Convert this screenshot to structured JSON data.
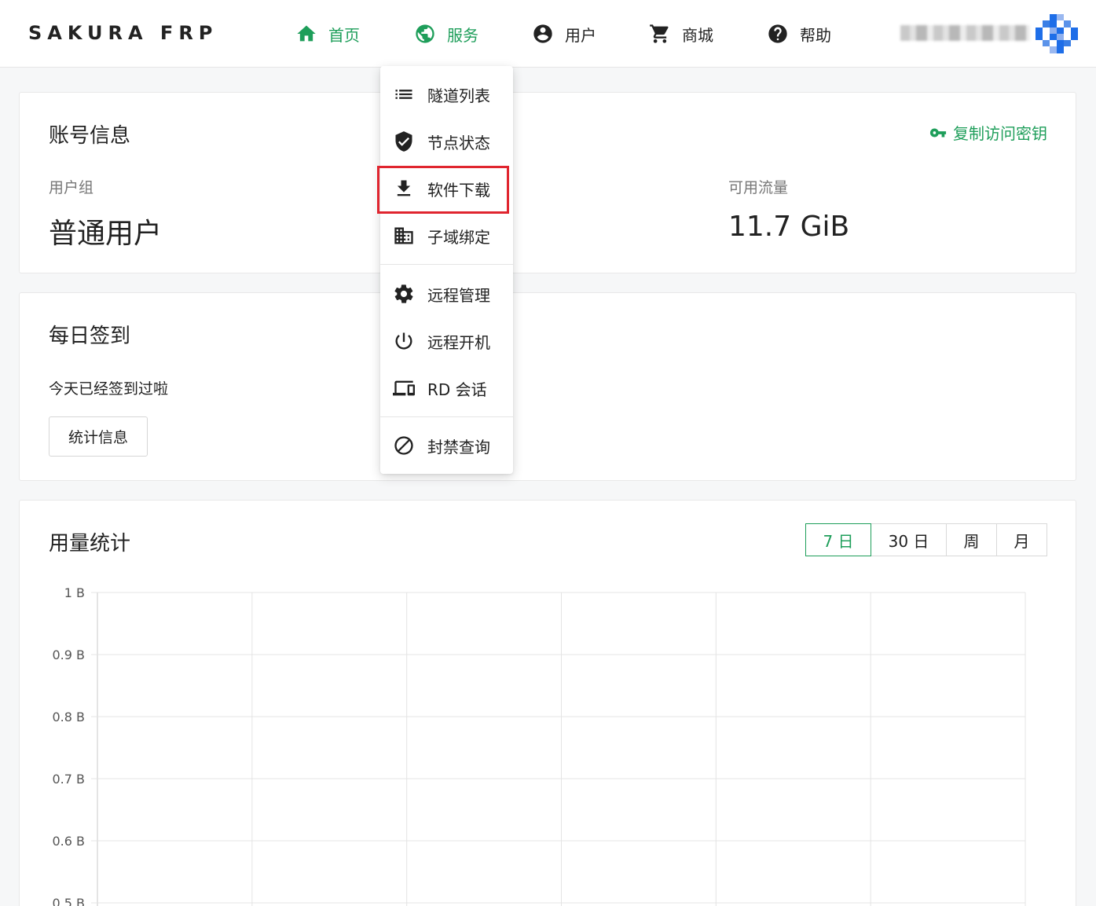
{
  "brand": "SAKURA FRP",
  "nav": {
    "home": "首页",
    "service": "服务",
    "user": "用户",
    "shop": "商城",
    "help": "帮助"
  },
  "service_menu": {
    "tunnels": "隧道列表",
    "nodes": "节点状态",
    "download": "软件下载",
    "subdomain": "子域绑定",
    "remote_manage": "远程管理",
    "remote_boot": "远程开机",
    "rd_session": "RD 会话",
    "ban_query": "封禁查询"
  },
  "account": {
    "title": "账号信息",
    "copy_key": "复制访问密钥",
    "group_label": "用户组",
    "group_value": "普通用户",
    "traffic_label": "可用流量",
    "traffic_value": "11.7 GiB"
  },
  "checkin": {
    "title": "每日签到",
    "status": "今天已经签到过啦",
    "stats_button": "统计信息"
  },
  "usage": {
    "title": "用量统计",
    "ranges": [
      "7 日",
      "30 日",
      "周",
      "月"
    ],
    "active_range": "7 日"
  },
  "colors": {
    "accent": "#1e9e5a",
    "highlight": "#e0252f"
  },
  "chart_data": {
    "type": "line",
    "title": "",
    "xlabel": "",
    "ylabel": "",
    "y_tick_labels": [
      "1 B",
      "0.9 B",
      "0.8 B",
      "0.7 B",
      "0.6 B",
      "0.5 B"
    ],
    "y_ticks": [
      1,
      0.9,
      0.8,
      0.7,
      0.6,
      0.5
    ],
    "x_tick_labels": [],
    "series": [],
    "grid": true
  }
}
